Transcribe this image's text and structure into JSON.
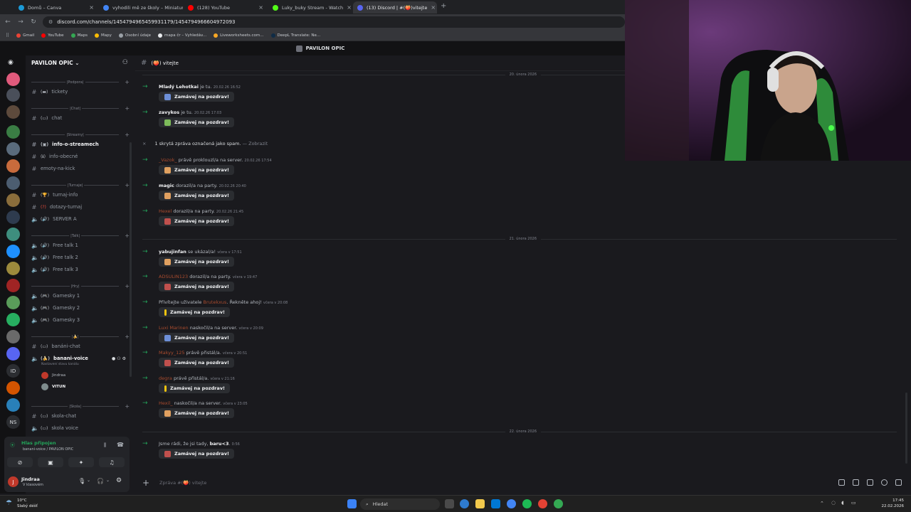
{
  "browser": {
    "tabs": [
      {
        "label": "Domů – Canva",
        "color": "#1b9ad7"
      },
      {
        "label": "vyhodili mě ze školy – Miniatur",
        "color": "#4285f4"
      },
      {
        "label": "(128) YouTube",
        "color": "#ff0000"
      },
      {
        "label": "Luky_buky Stream - Watch",
        "color": "#53fc18"
      },
      {
        "label": "(13) Discord | #(🍑)vitejte",
        "color": "#5865f2"
      }
    ],
    "url": "discord.com/channels/1454794965459931179/1454794966604972093",
    "bookmarks": [
      "Gmail",
      "YouTube",
      "Maps",
      "Mapy",
      "Osobní údaje",
      "mapa čr – Vyhledáv...",
      "Liveworksheets.com...",
      "DeepL Translate: Ne..."
    ]
  },
  "discord": {
    "window_title": "PAVILON OPIC",
    "server_name": "PAVILON OPIC",
    "categories": {
      "podpora": "|Podpora|",
      "chat": "|Chat|",
      "streamy": "|Streamy|",
      "turnaje": "|Turnaje|",
      "talk": "|Talk|",
      "hry": "|Hry|",
      "bananove": "|🍌|",
      "skola": "|Skola|"
    },
    "channels": {
      "tickety": "tickety",
      "chat": "chat",
      "info_streamech": "info-o-streamech",
      "info_obecne": "info-obecné",
      "emoty": "emoty-na-kick",
      "turnaj_info": "turnaj-info",
      "dotazy": "dotazy-turnaj",
      "server_a": "SERVER A",
      "free1": "Free talk 1",
      "free2": "Free talk 2",
      "free3": "Free talk 3",
      "gamesky1": "Gamesky 1",
      "gamesky2": "Gamesky 2",
      "gamesky3": "Gamesky 3",
      "banani_chat": "banáni-chat",
      "banani_voice": "banani-voice",
      "voice_status": "Nastavení stavu kanálu",
      "skola_chat": "skola-chat",
      "skola_voice": "skola voice"
    },
    "voice_users": [
      "Jindraa",
      "VITUN"
    ],
    "voice_panel": {
      "status": "Hlas připojen",
      "location": "banani-voice / PAVILON OPIC"
    },
    "user_panel": {
      "name": "Jindraa",
      "status": "V klasovém",
      "initial": "J"
    },
    "chat_header": "(🍑) vitejte",
    "dates": [
      "20. února 2026",
      "21. února 2026",
      "22. února 2026"
    ],
    "wave_label": "Zamávej na pozdrav!",
    "spam_notice": "1 skrytá zpráva označená jako spam.",
    "spam_link": "— Zobrazit",
    "messages": [
      {
        "user": "Mladý Lehotkai",
        "text": "je tu.",
        "time": "20.02.26 16:52"
      },
      {
        "user": "zavykos",
        "text": "je tu.",
        "time": "20.02.26 17:03"
      },
      {
        "user": "_Vazok_",
        "text": "právě proklouzl/a na server.",
        "time": "20.02.26 17:54"
      },
      {
        "user": "magic",
        "text": "dorazil/a na party.",
        "time": "20.02.26 20:40"
      },
      {
        "user": "Hexel",
        "text": "dorazil/a na party.",
        "time": "20.02.26 21:45"
      },
      {
        "user": "yabujinfan",
        "text": "se ukázal/a!",
        "time": "včera v 17:51"
      },
      {
        "user": "ADSULIN123",
        "text": "dorazil/a na party.",
        "time": "včera v 19:47"
      },
      {
        "pre": "Přivítejte uživatele",
        "user": "Brutekxus",
        "text": ". Řekněte ahoj!",
        "time": "včera v 20:08"
      },
      {
        "user": "Luxi Marinen",
        "text": "naskočil/a na server.",
        "time": "včera v 20:09"
      },
      {
        "user": "Makyy_125",
        "text": "právě přistál/a.",
        "time": "včera v 20:51"
      },
      {
        "user": "degra",
        "text": "právě přistál/a.",
        "time": "včera v 21:16"
      },
      {
        "user": "Hexil_",
        "text": "naskočil/a na server.",
        "time": "včera v 23:05"
      },
      {
        "pre": "Jsme rádi, že jsi tady,",
        "user": "baru<3",
        "text": ".",
        "time": "0:56"
      }
    ],
    "composer_placeholder": "Zpráva #(🍑) vitejte"
  },
  "taskbar": {
    "weather_temp": "10°C",
    "weather_desc": "Slabý déšť",
    "search": "Hledat",
    "time": "17:45",
    "date": "22.02.2026"
  }
}
